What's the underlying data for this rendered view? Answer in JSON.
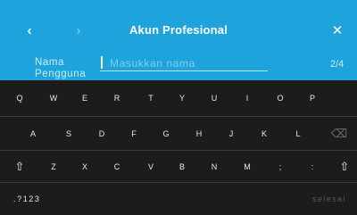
{
  "header": {
    "title": "Akun Profesional",
    "back_icon": "chevron-left-icon",
    "forward_icon": "chevron-right-icon",
    "close_icon": "close-icon",
    "back_glyph": "‹",
    "forward_glyph": "›",
    "close_glyph": "✕",
    "page_counter": "2/4",
    "background_color": "#1fa3dc"
  },
  "form": {
    "field_label": "Nama Pengguna",
    "name_input": {
      "value": "",
      "placeholder": "Masukkan nama"
    }
  },
  "keyboard": {
    "row1": [
      "Q",
      "W",
      "E",
      "R",
      "T",
      "Y",
      "U",
      "I",
      "O",
      "P"
    ],
    "row2": [
      "A",
      "S",
      "D",
      "F",
      "G",
      "H",
      "J",
      "K",
      "L"
    ],
    "row3": [
      "Z",
      "X",
      "C",
      "V",
      "B",
      "N",
      "M",
      ";",
      ":"
    ],
    "shift_glyph": "⇧",
    "backspace_glyph": "⌫",
    "numbers_label": ".?123",
    "done_label": "selesai",
    "background_color": "#1c1c1c"
  }
}
